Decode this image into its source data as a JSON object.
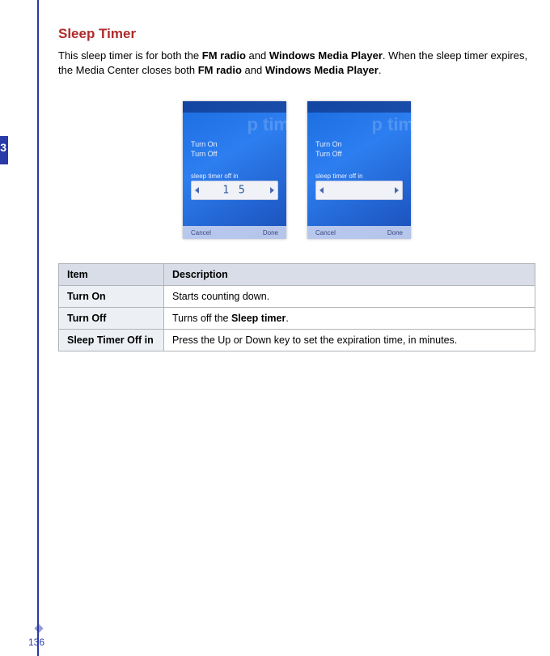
{
  "page_number": "136",
  "heading": "Sleep Timer",
  "intro": {
    "pre1": "This sleep timer is for both the ",
    "bold1": "FM radio",
    "mid1": " and ",
    "bold2": "Windows Media Player",
    "mid2": ". When the sleep timer expires, the Media Center closes both ",
    "bold3": "FM radio",
    "mid3": " and ",
    "bold4": "Windows Media Player",
    "post": "."
  },
  "screenshots": {
    "ghost_title": "p tim",
    "menu1": "Turn On",
    "menu2": "Turn Off",
    "slider_label": "sleep timer off in",
    "value_left": "1 5",
    "value_right": "",
    "softkey_left": "Cancel",
    "softkey_right": "Done"
  },
  "table": {
    "headers": {
      "item": "Item",
      "desc": "Description"
    },
    "rows": [
      {
        "item": "Turn On",
        "desc_pre": "Starts counting down.",
        "desc_bold": "",
        "desc_post": ""
      },
      {
        "item": "Turn Off",
        "desc_pre": "Turns off the ",
        "desc_bold": "Sleep timer",
        "desc_post": "."
      },
      {
        "item": "Sleep Timer Off in",
        "desc_pre": "Press the Up or Down key to set the expiration time, in minutes.",
        "desc_bold": "",
        "desc_post": ""
      }
    ]
  }
}
